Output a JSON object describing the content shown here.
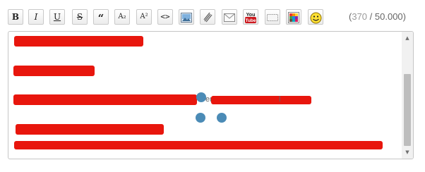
{
  "toolbar": {
    "bold_label": "B",
    "italic_label": "I",
    "underline_label": "U",
    "strike_label": "S",
    "quote_label": "“",
    "subscript_label": "A₂",
    "superscript_label": "A²",
    "code_label": "<>",
    "youtube_top": "You",
    "youtube_bottom": "Tube"
  },
  "char_count": {
    "open": "(",
    "current": "370",
    "separator": " / ",
    "max": "50.000",
    "close": ")"
  },
  "editor": {
    "stray_text": "erl",
    "stray_text_2": "l"
  },
  "colors": {
    "redaction": "#e8160d",
    "dot": "#4b8bb6",
    "youtube_red": "#cc181e"
  },
  "icons": [
    "bold-icon",
    "italic-icon",
    "underline-icon",
    "strikethrough-icon",
    "quote-icon",
    "subscript-icon",
    "superscript-icon",
    "code-icon",
    "image-icon",
    "attachment-icon",
    "email-icon",
    "youtube-icon",
    "spoiler-icon",
    "color-palette-icon",
    "smiley-icon"
  ]
}
